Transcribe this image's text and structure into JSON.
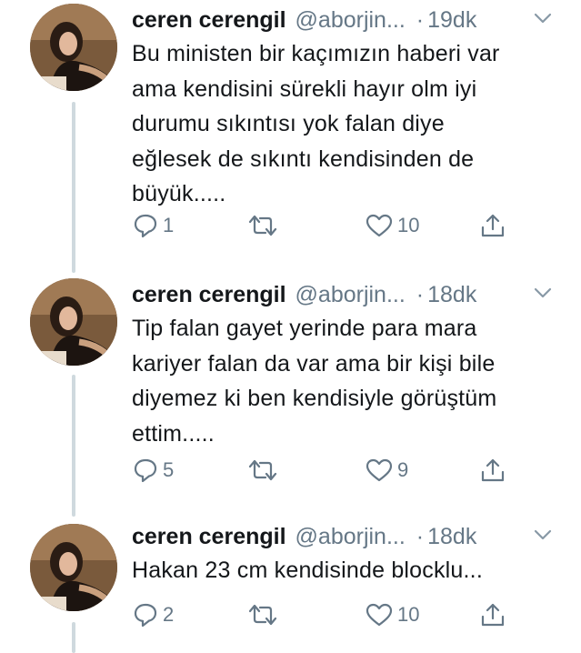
{
  "colors": {
    "text": "#14171a",
    "muted": "#657786",
    "thread_line": "#cfd9de"
  },
  "icons": {
    "reply": "reply-icon",
    "retweet": "retweet-icon",
    "like": "heart-icon",
    "share": "share-icon",
    "caret": "chevron-down-icon"
  },
  "tweets": [
    {
      "name": "ceren cerengil",
      "handle": "@aborjin...",
      "separator": "·",
      "time": "19dk",
      "text": "Bu ministen bir kaçımızın haberi var\nama kendisini sürekli hayır olm iyi\ndurumu sıkıntısı yok falan diye\neğlesek de sıkıntı kendisinden de\nbüyük.....",
      "replies": "1",
      "retweets": "",
      "likes": "10"
    },
    {
      "name": "ceren cerengil",
      "handle": "@aborjin...",
      "separator": "·",
      "time": "18dk",
      "text": "Tip falan gayet yerinde para mara\nkariyer falan da var ama bir kişi bile\ndiyemez ki ben kendisiyle görüştüm\nettim.....",
      "replies": "5",
      "retweets": "",
      "likes": "9"
    },
    {
      "name": "ceren cerengil",
      "handle": "@aborjin...",
      "separator": "·",
      "time": "18dk",
      "text": "Hakan 23 cm kendisinde blocklu...",
      "replies": "2",
      "retweets": "",
      "likes": "10"
    }
  ]
}
